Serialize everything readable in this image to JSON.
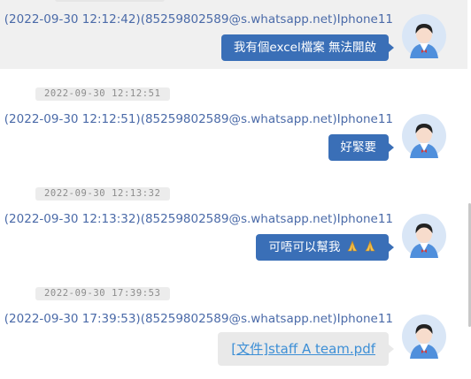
{
  "messages": [
    {
      "sender": "(2022-09-30 12:12:42)(85259802589@s.whatsapp.net)Iphone11",
      "text": "我有個excel檔案 無法開啟",
      "highlighted": true
    },
    {
      "timestamp": "2022-09-30 12:12:51",
      "sender": "(2022-09-30 12:12:51)(85259802589@s.whatsapp.net)Iphone11",
      "text": "好緊要"
    },
    {
      "timestamp": "2022-09-30 12:13:32",
      "sender": "(2022-09-30 12:13:32)(85259802589@s.whatsapp.net)Iphone11",
      "text": "可唔可以幫我",
      "emoji": [
        "folded-hands-icon",
        "folded-hands-icon"
      ]
    },
    {
      "timestamp": "2022-09-30 17:39:53",
      "sender": "(2022-09-30 17:39:53)(85259802589@s.whatsapp.net)Iphone11",
      "file_link": "[文件]staff A team.pdf"
    }
  ],
  "colors": {
    "bubble": "#3a6fb7",
    "sender_text": "#4a6aa8",
    "file_link": "#3d8fd6",
    "highlight": "#f0f0f0"
  }
}
